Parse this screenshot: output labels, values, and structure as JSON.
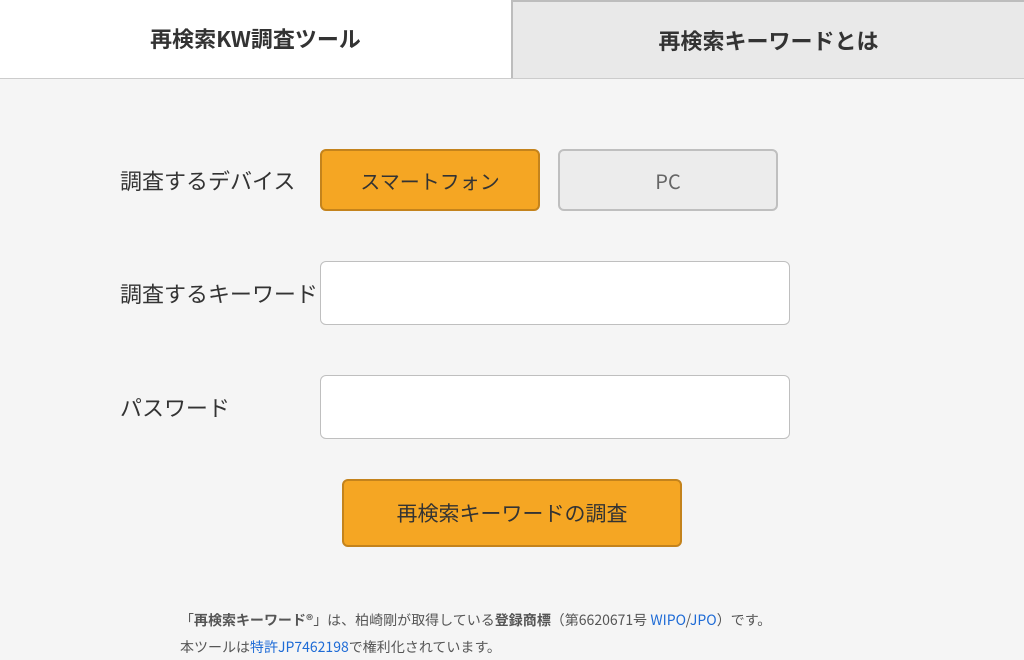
{
  "tabs": {
    "active": "再検索KW調査ツール",
    "inactive": "再検索キーワードとは"
  },
  "form": {
    "device_label": "調査するデバイス",
    "device_smartphone": "スマートフォン",
    "device_pc": "PC",
    "keyword_label": "調査するキーワード",
    "password_label": "パスワード",
    "submit_label": "再検索キーワードの調査"
  },
  "footer": {
    "line1_pre": "「",
    "line1_trademark": "再検索キーワード®",
    "line1_mid1": "」は、柏崎剛が取得している",
    "line1_mid2_strong": "登録商標",
    "line1_mid3": "（第6620671号 ",
    "wipo": "WIPO",
    "slash": "/",
    "jpo": "JPO",
    "line1_end": "）です。",
    "line2_pre": "本ツールは",
    "patent": "特許JP7462198",
    "line2_end": "で権利化されています。"
  }
}
